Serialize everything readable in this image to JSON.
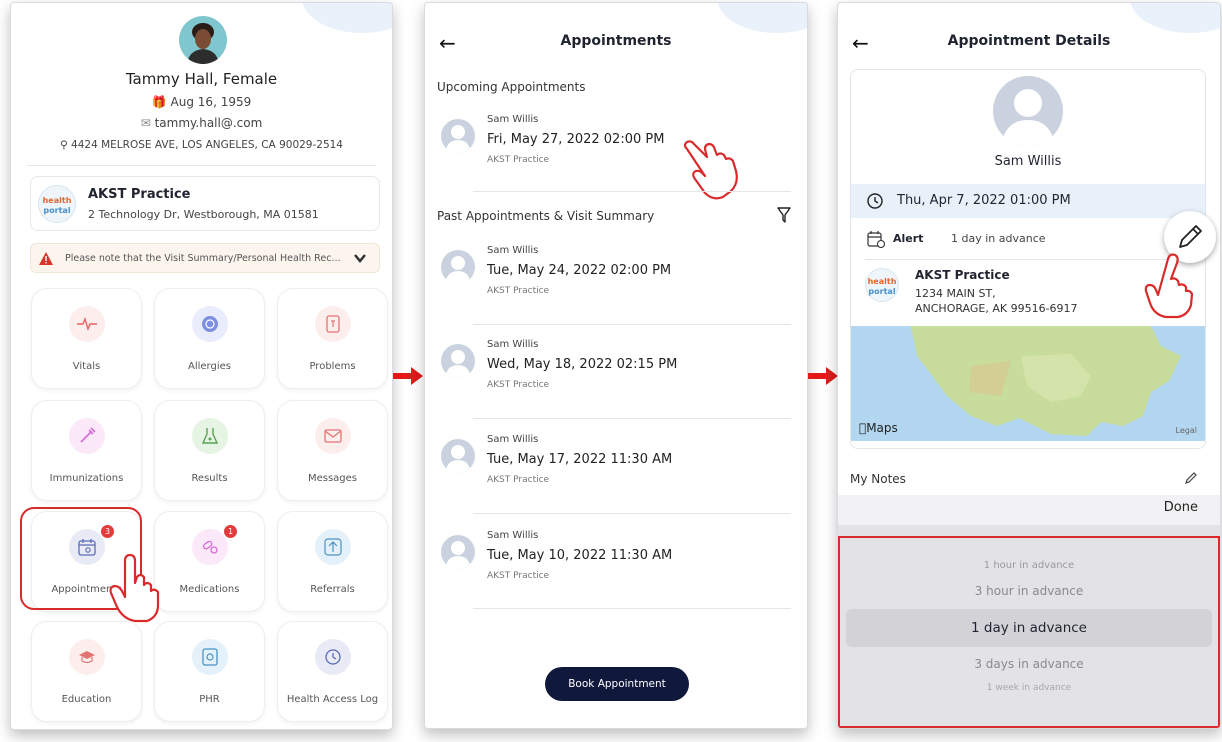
{
  "screen1": {
    "patient_name": "Tammy Hall, Female",
    "dob": "Aug 16, 1959",
    "email": "tammy.hall@.com",
    "address": "4424 MELROSE AVE, LOS ANGELES, CA 90029-2514",
    "practice": {
      "logo_top": "health",
      "logo_bottom": "portal",
      "name": "AKST Practice",
      "address": "2 Technology Dr, Westborough, MA 01581"
    },
    "notice": "Please note that the Visit Summary/Personal Health Rec...",
    "tiles": [
      {
        "label": "Vitals",
        "icon": "vitals-icon"
      },
      {
        "label": "Allergies",
        "icon": "allergies-icon"
      },
      {
        "label": "Problems",
        "icon": "problems-icon"
      },
      {
        "label": "Immunizations",
        "icon": "immunizations-icon"
      },
      {
        "label": "Results",
        "icon": "results-icon"
      },
      {
        "label": "Messages",
        "icon": "messages-icon"
      },
      {
        "label": "Appointments",
        "icon": "calendar-icon",
        "badge": "3"
      },
      {
        "label": "Medications",
        "icon": "pills-icon",
        "badge": "1"
      },
      {
        "label": "Referrals",
        "icon": "referrals-icon"
      },
      {
        "label": "Education",
        "icon": "education-icon"
      },
      {
        "label": "PHR",
        "icon": "phr-icon"
      },
      {
        "label": "Health Access Log",
        "icon": "access-log-icon"
      }
    ]
  },
  "screen2": {
    "title": "Appointments",
    "upcoming_label": "Upcoming Appointments",
    "past_label": "Past Appointments & Visit Summary",
    "upcoming": [
      {
        "name": "Sam Willis",
        "datetime": "Fri, May 27, 2022 02:00 PM",
        "practice": "AKST Practice"
      }
    ],
    "past": [
      {
        "name": "Sam Willis",
        "datetime": "Tue, May 24, 2022 02:00 PM",
        "practice": "AKST Practice"
      },
      {
        "name": "Sam Willis",
        "datetime": "Wed, May 18, 2022 02:15 PM",
        "practice": "AKST Practice"
      },
      {
        "name": "Sam Willis",
        "datetime": "Tue, May 17, 2022 11:30 AM",
        "practice": "AKST Practice"
      },
      {
        "name": "Sam Willis",
        "datetime": "Tue, May 10, 2022 11:30 AM",
        "practice": "AKST Practice"
      }
    ],
    "book_button": "Book Appointment"
  },
  "screen3": {
    "title": "Appointment Details",
    "doctor": "Sam Willis",
    "datetime": "Thu, Apr 7, 2022 01:00 PM",
    "alert_label": "Alert",
    "alert_value": "1 day in advance",
    "practice": {
      "logo_top": "health",
      "logo_bottom": "portal",
      "name": "AKST Practice",
      "address1": "1234 MAIN ST,",
      "address2": "ANCHORAGE, AK 99516-6917"
    },
    "map_brand": "Maps",
    "map_legal": "Legal",
    "notes_label": "My Notes",
    "done_label": "Done",
    "picker_options": [
      "1 hour in advance",
      "3 hour in advance",
      "1 day in advance",
      "3 days in advance",
      "1 week in advance"
    ],
    "picker_selected": "1 day in advance"
  },
  "colors": {
    "accent_red": "#d92b2b",
    "button_navy": "#10183c",
    "highlight_row": "#e8f1fa"
  }
}
